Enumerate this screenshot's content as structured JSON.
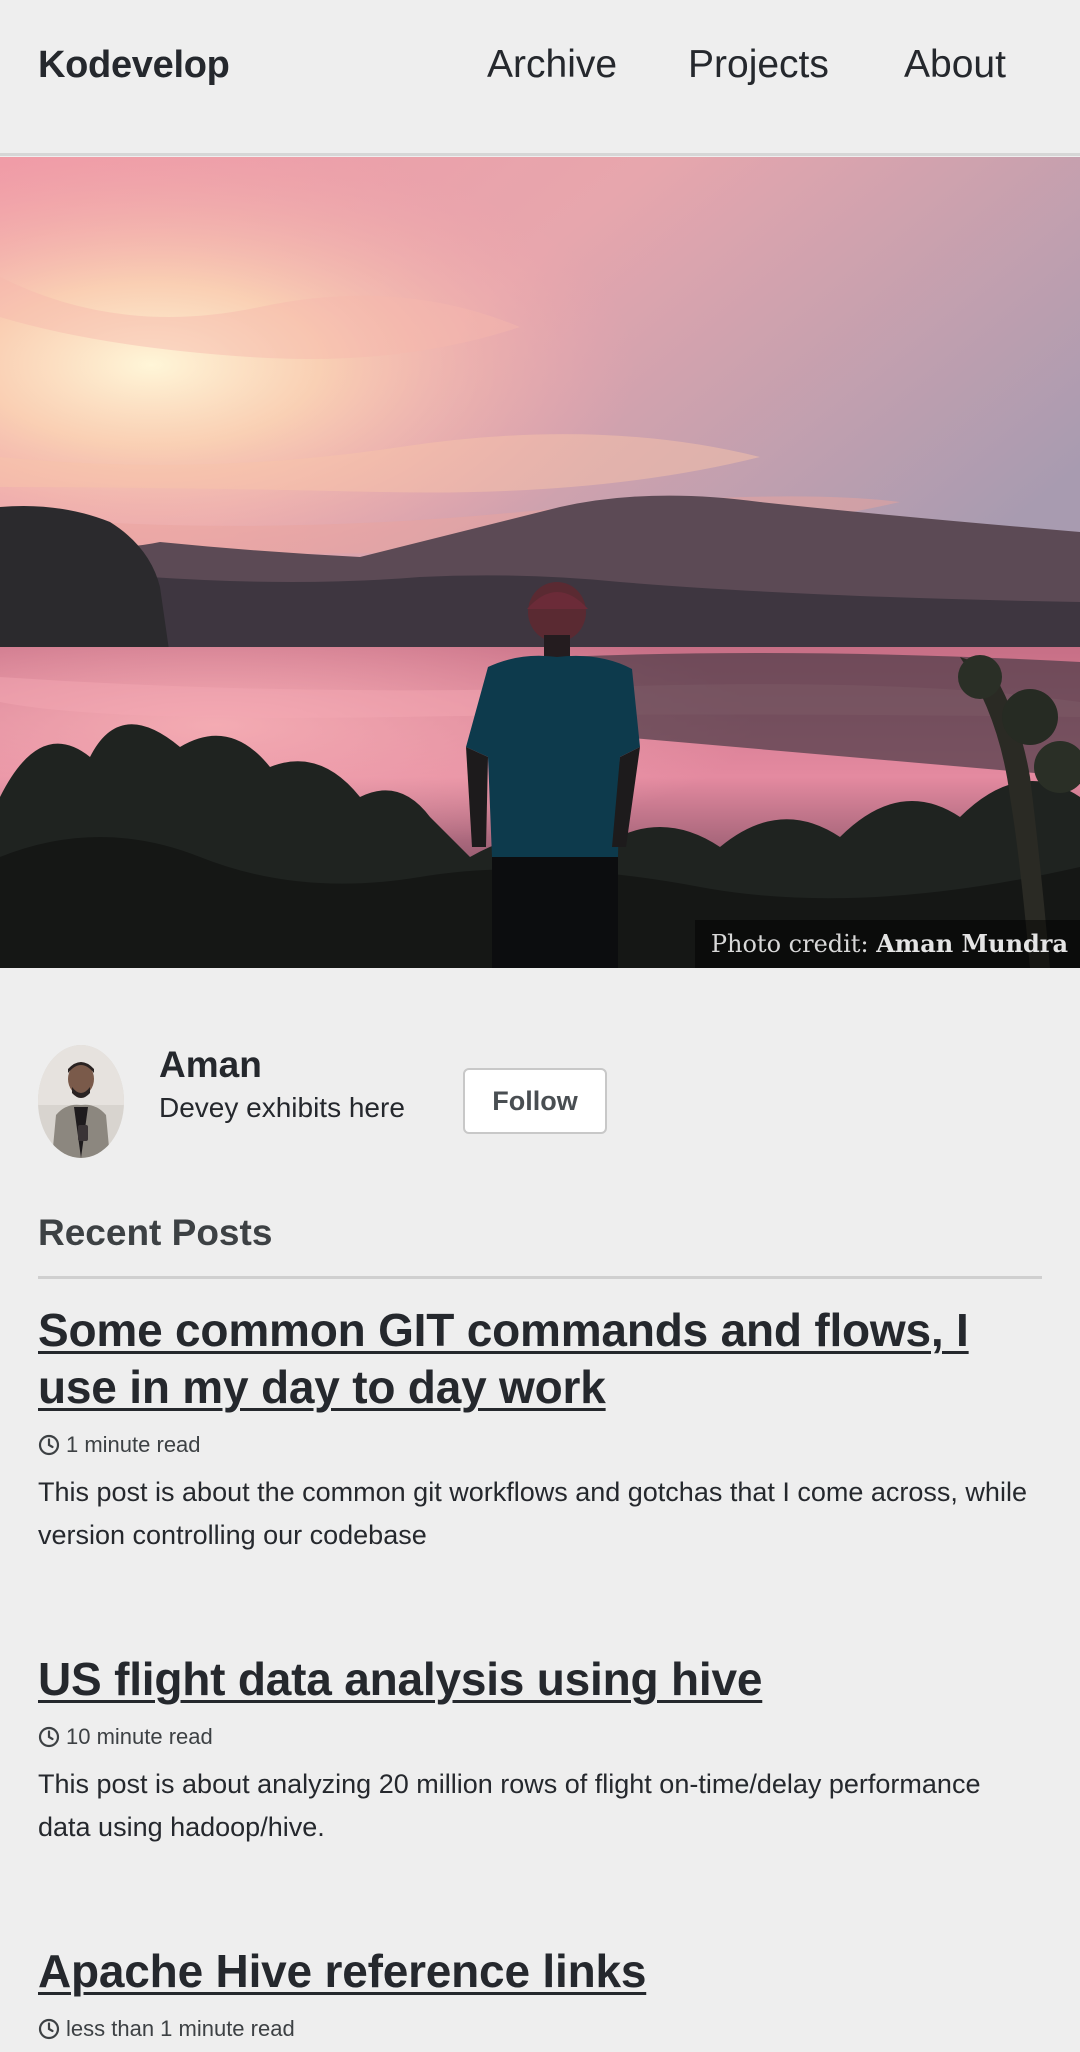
{
  "masthead": {
    "site_title": "Kodevelop",
    "nav": [
      {
        "label": "Archive"
      },
      {
        "label": "Projects"
      },
      {
        "label": "About"
      }
    ]
  },
  "hero": {
    "credit_prefix": "Photo credit:",
    "credit_name": "Aman Mundra"
  },
  "author": {
    "name": "Aman",
    "bio": "Devey exhibits here",
    "follow_label": "Follow"
  },
  "recent_posts": {
    "heading": "Recent Posts",
    "posts": [
      {
        "title": "Some common GIT commands and flows, I use in my day to day work",
        "read_time": "1 minute read",
        "excerpt": "This post is about the common git workflows and gotchas that I come across, while version controlling our codebase"
      },
      {
        "title": "US flight data analysis using hive",
        "read_time": "10 minute read",
        "excerpt": "This post is about analyzing 20 million rows of flight on-time/delay performance data using hadoop/hive."
      },
      {
        "title": "Apache Hive reference links",
        "read_time": "less than 1 minute read"
      }
    ]
  },
  "icons": {
    "clock": "clock-icon"
  }
}
